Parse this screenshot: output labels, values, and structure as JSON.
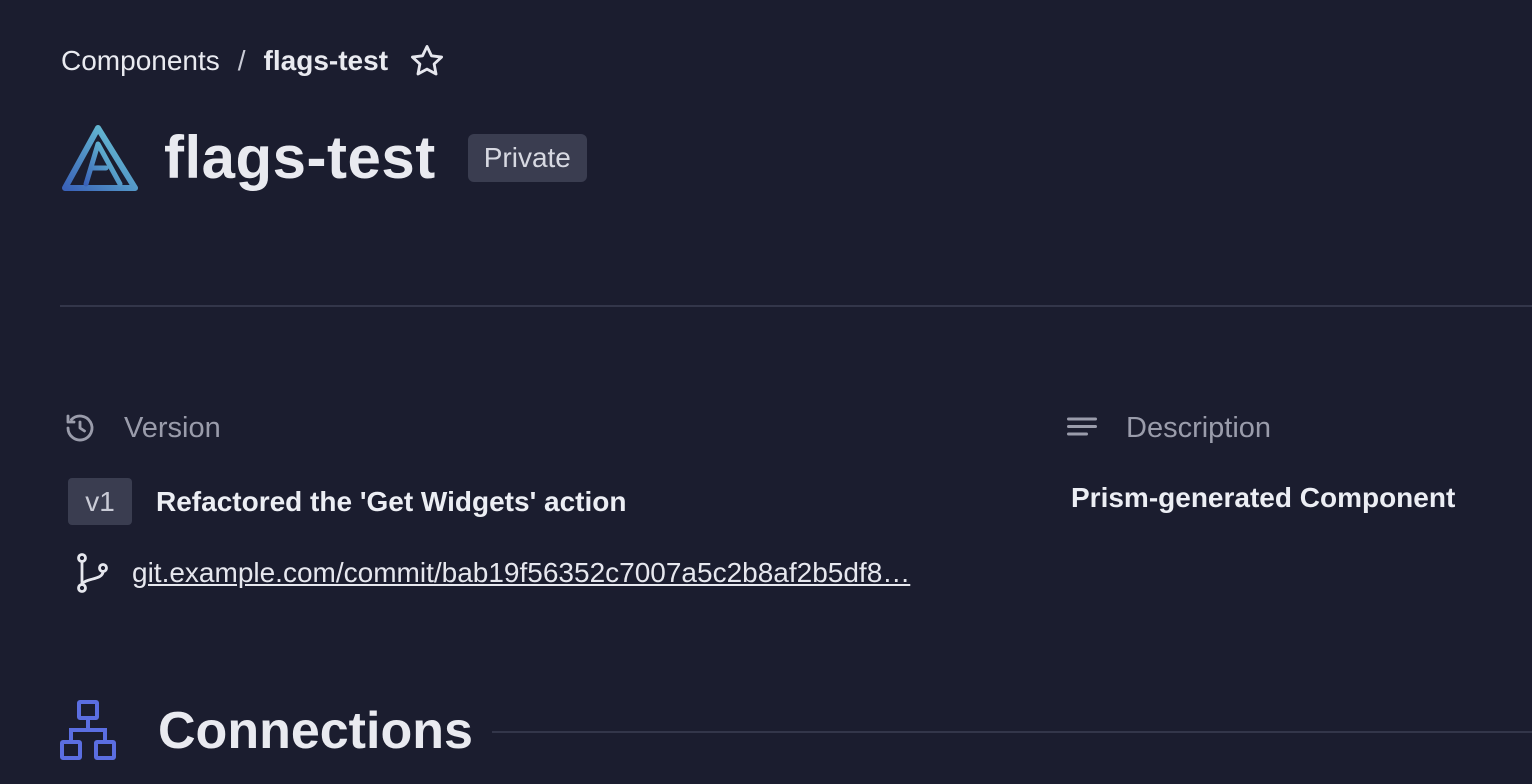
{
  "breadcrumb": {
    "parent": "Components",
    "separator": "/",
    "current": "flags-test"
  },
  "header": {
    "title": "flags-test",
    "visibility_badge": "Private",
    "logo_icon": "prism-triangle-logo-icon",
    "star_icon": "star-outline-icon"
  },
  "version": {
    "label": "Version",
    "icon": "history-icon",
    "tag": "v1",
    "message": "Refactored the 'Get Widgets' action",
    "commit_icon": "git-branch-icon",
    "commit_url": "git.example.com/commit/bab19f56352c7007a5c2b8af2b5df8…"
  },
  "description": {
    "label": "Description",
    "icon": "text-lines-icon",
    "text": "Prism-generated Component"
  },
  "connections": {
    "title": "Connections",
    "icon": "network-hierarchy-icon",
    "icon_color": "#5b6ee1"
  },
  "colors": {
    "background": "#1b1d2f",
    "badge_bg": "#3a3d50",
    "muted_text": "#9a9cab",
    "accent": "#5b6ee1"
  }
}
